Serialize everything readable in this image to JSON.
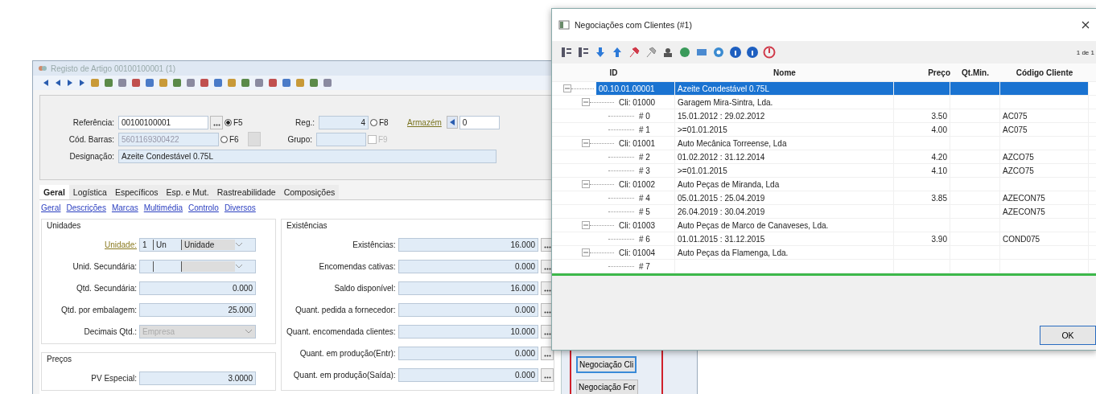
{
  "main_window": {
    "title": "Registo de Artigo 00100100001 (1)",
    "header": {
      "referencia": {
        "label": "Referência:",
        "value": "00100100001"
      },
      "radios": [
        {
          "label": "F5",
          "selected": true
        },
        {
          "label": "F6",
          "selected": false
        },
        {
          "label": "F8",
          "selected": false
        }
      ],
      "reg": {
        "label": "Reg.:",
        "value": "4"
      },
      "armazem": {
        "label": "Armazém",
        "value": "0"
      },
      "cod_barras": {
        "label": "Cód. Barras:",
        "value": "5601169300422"
      },
      "grupo": {
        "label": "Grupo:"
      },
      "f9_checkbox": {
        "label": "F9",
        "checked": false,
        "disabled": true
      },
      "designacao": {
        "label": "Designação:",
        "value": "Azeite Condestável 0.75L"
      }
    },
    "tabs": [
      {
        "label": "Geral",
        "selected": true
      },
      {
        "label": "Logística",
        "selected": false
      },
      {
        "label": "Específicos",
        "selected": false
      },
      {
        "label": "Esp. e Mut.",
        "selected": false
      },
      {
        "label": "Rastreabilidade",
        "selected": false
      },
      {
        "label": "Composições",
        "selected": false
      }
    ],
    "sub_links": [
      "Geral",
      "Descrições",
      "Marcas",
      "Multimédia",
      "Controlo",
      "Diversos"
    ],
    "unidades": {
      "title": "Unidades",
      "rows": [
        {
          "kind": "unit",
          "label": "Unidade:",
          "link": true,
          "segments": [
            "1",
            "Un",
            "Unidade"
          ]
        },
        {
          "kind": "unit_blank",
          "label": "Unid. Secundária:",
          "link": false
        },
        {
          "kind": "number",
          "label": "Qtd. Secundária:",
          "link": false,
          "value": "0.000"
        },
        {
          "kind": "number",
          "label": "Qtd. por embalagem:",
          "link": false,
          "value": "25.000"
        },
        {
          "kind": "select",
          "label": "Decimais Qtd.:",
          "link": false,
          "value": "Empresa"
        }
      ]
    },
    "precos": {
      "title": "Preços",
      "rows": [
        {
          "kind": "number",
          "label": "PV Especial:",
          "link": false,
          "value": "3.0000"
        }
      ]
    },
    "existencias": {
      "title": "Existências",
      "rows": [
        {
          "label": "Existências:",
          "value": "16.000"
        },
        {
          "label": "Encomendas cativas:",
          "value": "0.000"
        },
        {
          "label": "Saldo disponível:",
          "value": "16.000"
        },
        {
          "label": "Quant. pedida a fornecedor:",
          "value": "0.000"
        },
        {
          "label": "Quant. encomendada clientes:",
          "value": "10.000"
        },
        {
          "label": "Quant. em produção(Entr):",
          "value": "0.000"
        },
        {
          "label": "Quant. em produção(Saída):",
          "value": "0.000"
        }
      ]
    },
    "side_buttons": [
      {
        "label": "Negociação Cli",
        "focused": true
      },
      {
        "label": "Negociação For",
        "focused": false
      }
    ]
  },
  "dialog": {
    "title": "Negociações com Clientes (#1)",
    "counter": "1 de 1",
    "columns": [
      "ID",
      "Nome",
      "Preço",
      "Qt.Min.",
      "Código Cliente"
    ],
    "rows": [
      {
        "id": "00.10.01.00001",
        "nome": "Azeite Condestável 0.75L",
        "selected": true,
        "expanded": true,
        "children": [
          {
            "id": "Cli: 01000",
            "nome": "Garagem Mira-Sintra, Lda.",
            "selected": false,
            "expanded": true,
            "children": [
              {
                "id": "# 0",
                "nome": "15.01.2012 : 29.02.2012",
                "preco": "3.50",
                "codigo": "AC075",
                "selected": false
              },
              {
                "id": "# 1",
                "nome": ">=01.01.2015",
                "preco": "4.00",
                "codigo": "AC075",
                "selected": false
              }
            ]
          },
          {
            "id": "Cli: 01001",
            "nome": "Auto Mecânica Torreense, Lda",
            "selected": false,
            "expanded": true,
            "children": [
              {
                "id": "# 2",
                "nome": "01.02.2012 : 31.12.2014",
                "preco": "4.20",
                "codigo": "AZCO75",
                "selected": false
              },
              {
                "id": "# 3",
                "nome": ">=01.01.2015",
                "preco": "4.10",
                "codigo": "AZCO75",
                "selected": false
              }
            ]
          },
          {
            "id": "Cli: 01002",
            "nome": "Auto Peças de Miranda, Lda",
            "selected": false,
            "expanded": true,
            "children": [
              {
                "id": "# 4",
                "nome": "05.01.2015 : 25.04.2019",
                "preco": "3.85",
                "codigo": "AZECON75",
                "selected": false
              },
              {
                "id": "# 5",
                "nome": "26.04.2019 : 30.04.2019",
                "codigo": "AZECON75",
                "selected": false
              }
            ]
          },
          {
            "id": "Cli: 01003",
            "nome": "Auto Peças de Marco de Canaveses, Lda.",
            "selected": false,
            "expanded": true,
            "children": [
              {
                "id": "# 6",
                "nome": "01.01.2015 : 31.12.2015",
                "preco": "3.90",
                "codigo": "COND075",
                "selected": false
              }
            ]
          },
          {
            "id": "Cli: 01004",
            "nome": "Auto Peças da Flamenga, Lda.",
            "selected": false,
            "expanded": true,
            "children": [
              {
                "id": "# 7",
                "selected": false
              }
            ]
          }
        ]
      }
    ],
    "ok_button": "OK"
  }
}
